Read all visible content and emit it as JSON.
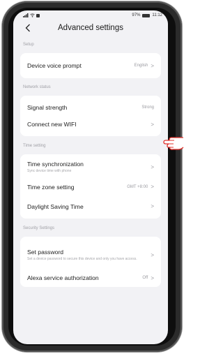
{
  "statusbar": {
    "left_icons": [
      "signal-icon",
      "wifi-icon",
      "notification-icon"
    ],
    "battery_text": "97%",
    "time": "11:12"
  },
  "nav": {
    "title": "Advanced settings",
    "back_icon": "chevron-left-icon"
  },
  "sections": {
    "setup": {
      "title": "Setup",
      "device_voice_prompt": {
        "label": "Device voice prompt",
        "value": "English"
      }
    },
    "network": {
      "title": "Network status",
      "signal_strength": {
        "label": "Signal strength",
        "value": "Strong"
      },
      "connect_new_wifi": {
        "label": "Connect new WIFI"
      }
    },
    "time": {
      "title": "Time setting",
      "time_sync": {
        "label": "Time synchronization",
        "sub": "Sync device time with phone"
      },
      "time_zone": {
        "label": "Time zone setting",
        "value": "GMT +8:00"
      },
      "daylight": {
        "label": "Daylight Saving Time"
      }
    },
    "security": {
      "title": "Security Settings",
      "set_password": {
        "label": "Set password",
        "sub": "Set a device password to secure this device and only you have access."
      },
      "alexa": {
        "label": "Alexa service authorization",
        "value": "Off"
      }
    }
  },
  "chevron": ">",
  "pointer_icon": "hand-pointer-icon",
  "colors": {
    "background": "#f2f2f5",
    "card": "#ffffff",
    "pointer": "#e0302a"
  }
}
